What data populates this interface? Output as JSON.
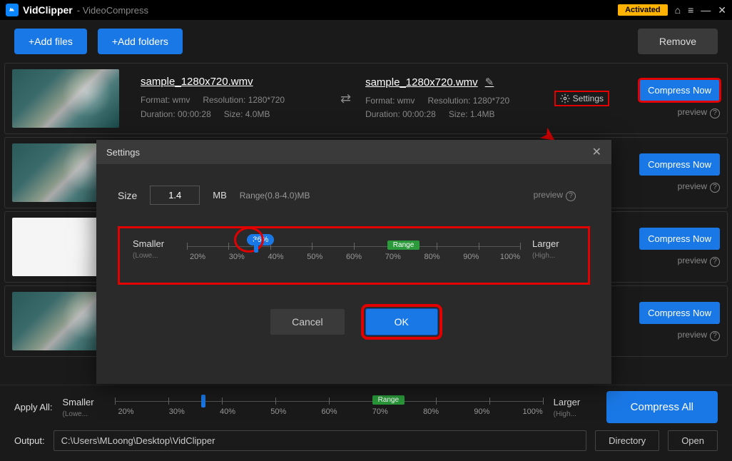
{
  "titlebar": {
    "app": "VidClipper",
    "sub": "- VideoCompress",
    "activated": "Activated"
  },
  "toolbar": {
    "add_files": "+Add files",
    "add_folders": "+Add folders",
    "remove": "Remove"
  },
  "file": {
    "name": "sample_1280x720.wmv",
    "format_l": "Format: wmv",
    "res_l": "Resolution: 1280*720",
    "dur_l": "Duration: 00:00:28",
    "size_src": "Size: 4.0MB",
    "format_r": "Format: wmv",
    "res_r": "Resolution: 1280*720",
    "dur_r": "Duration: 00:00:28",
    "size_out": "Size: 1.4MB",
    "settings_label": "Settings"
  },
  "row_btn": "Compress Now",
  "preview": "preview",
  "modal": {
    "title": "Settings",
    "size_label": "Size",
    "size_value": "1.4",
    "unit": "MB",
    "range": "Range(0.8-4.0)MB",
    "preview": "preview",
    "smaller": "Smaller",
    "smaller_sub": "(Lowe...",
    "larger": "Larger",
    "larger_sub": "(High...",
    "percent": "36%",
    "range_badge": "Range",
    "ticks": [
      "20%",
      "30%",
      "40%",
      "50%",
      "60%",
      "70%",
      "80%",
      "90%",
      "100%"
    ],
    "cancel": "Cancel",
    "ok": "OK"
  },
  "bottom": {
    "apply_all": "Apply All:",
    "smaller": "Smaller",
    "smaller_sub": "(Lowe...",
    "larger": "Larger",
    "larger_sub": "(High...",
    "range": "Range",
    "ticks": [
      "20%",
      "30%",
      "40%",
      "50%",
      "60%",
      "70%",
      "80%",
      "90%",
      "100%"
    ],
    "compress_all": "Compress All",
    "output": "Output:",
    "path": "C:\\Users\\MLoong\\Desktop\\VidClipper",
    "directory": "Directory",
    "open": "Open"
  }
}
